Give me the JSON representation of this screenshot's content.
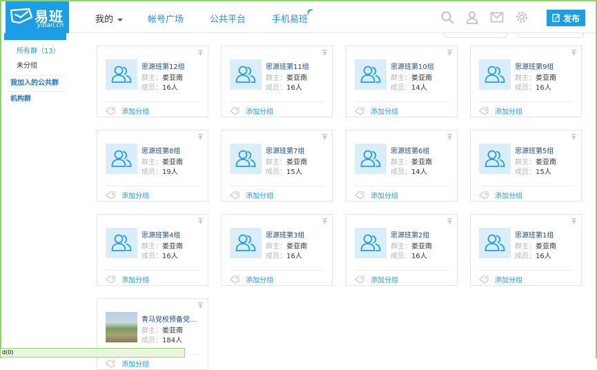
{
  "logo": {
    "name": "易班",
    "url": "yiban.cn"
  },
  "nav": {
    "mine": "我的",
    "items": [
      "帐号广场",
      "公共平台",
      "手机易班"
    ]
  },
  "header": {
    "publish": "发布"
  },
  "sidebar": {
    "all_groups": "所有群（13）",
    "ungrouped": "未分组",
    "joined_public": "我加入的公共群",
    "org_groups": "机构群"
  },
  "card_labels": {
    "owner": "群主：",
    "members": "成员：",
    "add_group": "添加分组"
  },
  "groups": [
    {
      "name": "思源班第12组",
      "owner": "娄亚南",
      "members": "16人"
    },
    {
      "name": "思源班第11组",
      "owner": "娄亚南",
      "members": "16人"
    },
    {
      "name": "思源班第10组",
      "owner": "娄亚南",
      "members": "14人"
    },
    {
      "name": "思源班第9组",
      "owner": "娄亚南",
      "members": "16人"
    },
    {
      "name": "思源班第8组",
      "owner": "娄亚南",
      "members": "19人"
    },
    {
      "name": "思源班第7组",
      "owner": "娄亚南",
      "members": "15人"
    },
    {
      "name": "思源班第6组",
      "owner": "娄亚南",
      "members": "14人"
    },
    {
      "name": "思源班第5组",
      "owner": "娄亚南",
      "members": "15人"
    },
    {
      "name": "思源班第4组",
      "owner": "娄亚南",
      "members": "16人"
    },
    {
      "name": "思源班第3组",
      "owner": "娄亚南",
      "members": "16人"
    },
    {
      "name": "思源班第2组",
      "owner": "娄亚南",
      "members": "16人"
    },
    {
      "name": "思源班第1组",
      "owner": "娄亚南",
      "members": "16人"
    },
    {
      "name": "青马党校预备党...",
      "owner": "娄亚南",
      "members": "184人"
    }
  ],
  "statusbar": {
    "text": "d(0)"
  },
  "colors": {
    "brand": "#1a9ee8",
    "status_bar": "#eaf6dc"
  }
}
